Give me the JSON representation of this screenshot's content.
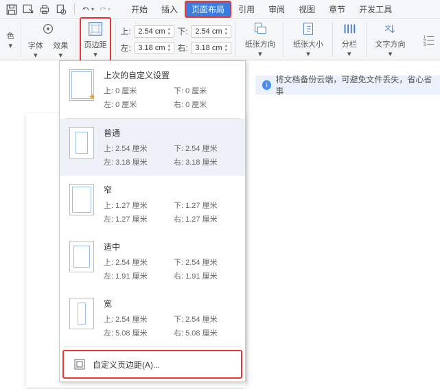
{
  "tabs": {
    "start": "开始",
    "insert": "插入",
    "page_layout": "页面布局",
    "references": "引用",
    "review": "审阅",
    "view": "视图",
    "chapter": "章节",
    "dev_tools": "开发工具"
  },
  "ribbon": {
    "color_label": "色 ▾",
    "font_label": "字体 ▾",
    "effects_label": "效果 ▾",
    "margins_label": "页边距 ▾",
    "top_label": "上:",
    "bottom_label": "下:",
    "left_label": "左:",
    "right_label": "右:",
    "top_value": "2.54 cm",
    "bottom_value": "2.54 cm",
    "left_value": "3.18 cm",
    "right_value": "3.18 cm",
    "orientation_label": "纸张方向 ▾",
    "size_label": "纸张大小 ▾",
    "columns_label": "分栏 ▾",
    "text_direction_label": "文字方向 ▾"
  },
  "info_bar": "将文档备份云端，可避免文件丢失，省心省事",
  "dropdown": {
    "last_custom": {
      "title": "上次的自定义设置",
      "top": "上: 0 厘米",
      "bottom": "下: 0 厘米",
      "left": "左: 0 厘米",
      "right": "右: 0 厘米"
    },
    "normal": {
      "title": "普通",
      "top": "上: 2.54 厘米",
      "bottom": "下: 2.54 厘米",
      "left": "左: 3.18 厘米",
      "right": "右: 3.18 厘米"
    },
    "narrow": {
      "title": "窄",
      "top": "上: 1.27 厘米",
      "bottom": "下: 1.27 厘米",
      "left": "左: 1.27 厘米",
      "right": "右: 1.27 厘米"
    },
    "moderate": {
      "title": "适中",
      "top": "上: 2.54 厘米",
      "bottom": "下: 2.54 厘米",
      "left": "左: 1.91 厘米",
      "right": "右: 1.91 厘米"
    },
    "wide": {
      "title": "宽",
      "top": "上: 2.54 厘米",
      "bottom": "下: 2.54 厘米",
      "left": "左: 5.08 厘米",
      "right": "右: 5.08 厘米"
    },
    "custom": "自定义页边距(A)..."
  }
}
